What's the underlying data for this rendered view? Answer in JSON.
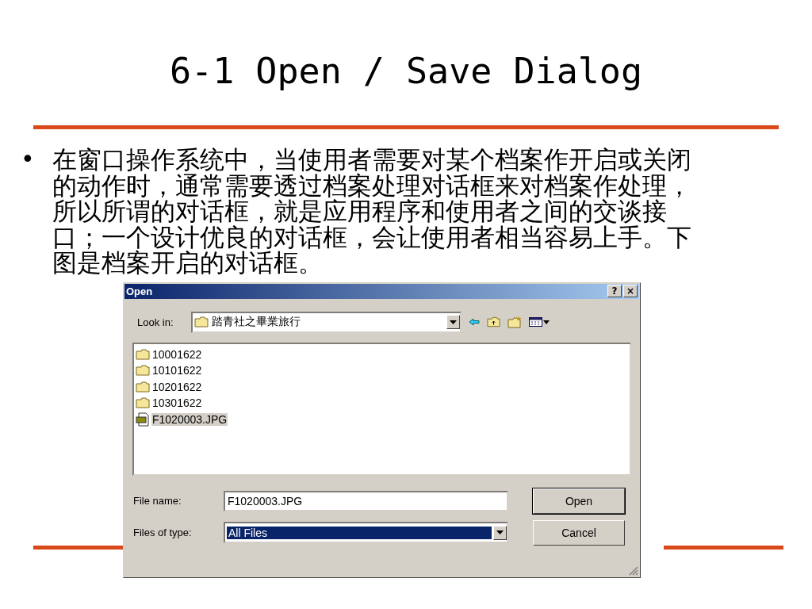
{
  "slide": {
    "title": "6-1 Open / Save Dialog",
    "bullet": "•",
    "paragraph": "在窗口操作系统中，当使用者需要对某个档案作开启或关闭的动作时，通常需要透过档案处理对话框来对档案作处理，所以所谓的对话框，就是应用程序和使用者之间的交谈接口；一个设计优良的对话框，会让使用者相当容易上手。下图是档案开启的对话框。"
  },
  "dialog": {
    "title": "Open",
    "title_buttons": [
      "?",
      "×"
    ],
    "look_in": {
      "label": "Look in:",
      "value": "踏青社之畢業旅行"
    },
    "files": [
      {
        "name": "10001622",
        "kind": "folder",
        "selected": false
      },
      {
        "name": "10101622",
        "kind": "folder",
        "selected": false
      },
      {
        "name": "10201622",
        "kind": "folder",
        "selected": false
      },
      {
        "name": "10301622",
        "kind": "folder",
        "selected": false
      },
      {
        "name": "F1020003.JPG",
        "kind": "image",
        "selected": true
      }
    ],
    "file_name": {
      "label": "File name:",
      "value": "F1020003.JPG"
    },
    "file_type": {
      "label": "Files of type:",
      "value": "All Files",
      "focused": true
    },
    "buttons": [
      "Open",
      "Cancel"
    ]
  }
}
